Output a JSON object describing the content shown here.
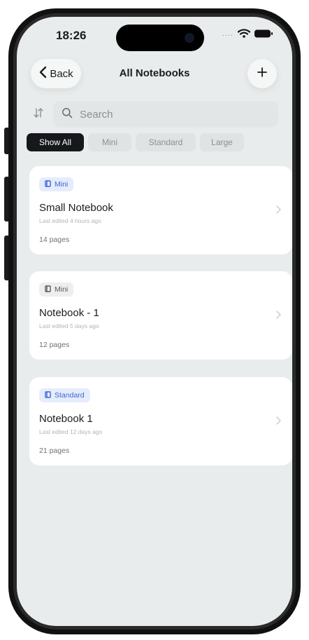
{
  "status_bar": {
    "time": "18:26",
    "signal": "....",
    "icons": [
      "wifi-icon",
      "battery-icon"
    ]
  },
  "nav": {
    "back_label": "Back",
    "title": "All Notebooks",
    "add_icon": "plus-icon",
    "back_icon": "chevron-left-icon"
  },
  "search": {
    "placeholder": "Search",
    "value": "",
    "sort_icon": "sort-icon",
    "search_icon": "search-icon"
  },
  "filters": [
    {
      "label": "Show All",
      "active": true
    },
    {
      "label": "Mini",
      "active": false
    },
    {
      "label": "Standard",
      "active": false
    },
    {
      "label": "Large",
      "active": false
    }
  ],
  "notebooks": [
    {
      "tag": "Mini",
      "tag_style": "blue",
      "title": "Small Notebook",
      "last_edited": "Last edited 4 hours ago",
      "pages": "14 pages"
    },
    {
      "tag": "Mini",
      "tag_style": "gray",
      "title": "Notebook - 1",
      "last_edited": "Last edited 5 days ago",
      "pages": "12 pages"
    },
    {
      "tag": "Standard",
      "tag_style": "blue",
      "title": "Notebook 1",
      "last_edited": "Last edited 12 days ago",
      "pages": "21 pages"
    }
  ],
  "colors": {
    "accent": "#3a66d6",
    "active_chip": "#16181b",
    "screen_bg": "#e9ecec"
  }
}
